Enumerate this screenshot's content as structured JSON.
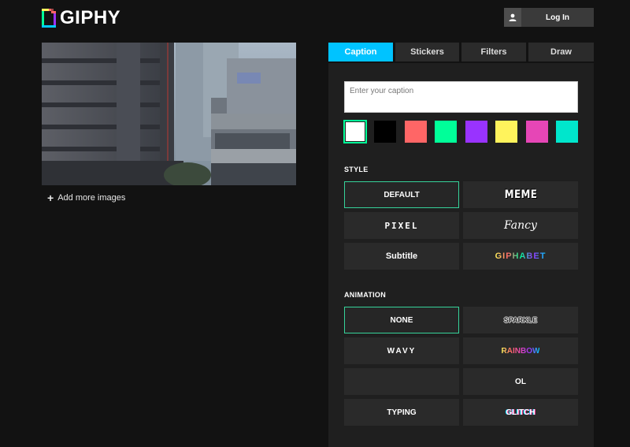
{
  "header": {
    "logo_text": "GIPHY",
    "login_label": "Log In",
    "user_icon": "user-icon"
  },
  "preview": {
    "add_more_label": "Add more images",
    "plus_icon": "plus-icon"
  },
  "tabs": [
    {
      "label": "Caption",
      "active": true
    },
    {
      "label": "Stickers",
      "active": false
    },
    {
      "label": "Filters",
      "active": false
    },
    {
      "label": "Draw",
      "active": false
    }
  ],
  "caption": {
    "placeholder": "Enter your caption",
    "value": ""
  },
  "colors": [
    {
      "hex": "#ffffff",
      "selected": true
    },
    {
      "hex": "#000000",
      "selected": false
    },
    {
      "hex": "#ff6666",
      "selected": false
    },
    {
      "hex": "#00ff99",
      "selected": false
    },
    {
      "hex": "#9933ff",
      "selected": false
    },
    {
      "hex": "#fff35c",
      "selected": false
    },
    {
      "hex": "#e646b6",
      "selected": false
    },
    {
      "hex": "#00e6cc",
      "selected": false
    }
  ],
  "style": {
    "label": "STYLE",
    "options": [
      {
        "label": "DEFAULT",
        "selected": true
      },
      {
        "label": "MEME",
        "selected": false
      },
      {
        "label": "PIXEL",
        "selected": false
      },
      {
        "label": "Fancy",
        "selected": false
      },
      {
        "label": "Subtitle",
        "selected": false
      },
      {
        "label": "GIPHABET",
        "selected": false
      }
    ]
  },
  "animation": {
    "label": "ANIMATION",
    "options": [
      {
        "label": "NONE",
        "selected": true
      },
      {
        "label": "SPARKLE",
        "selected": false
      },
      {
        "label": "WAVY",
        "selected": false
      },
      {
        "label": "RAINBOW",
        "selected": false
      },
      {
        "label": "",
        "selected": false
      },
      {
        "label": "OL",
        "selected": false
      },
      {
        "label": "TYPING",
        "selected": false
      },
      {
        "label": "GLITCH",
        "selected": false
      }
    ]
  }
}
